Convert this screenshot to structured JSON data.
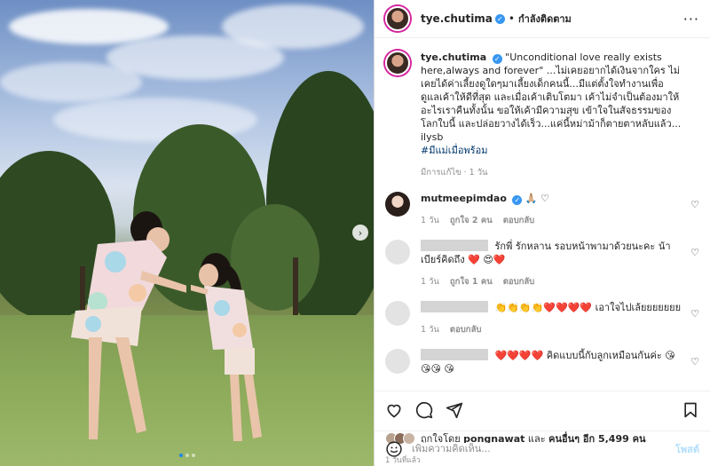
{
  "colors": {
    "accent": "#0095f6",
    "verified": "#3897f0",
    "heart": "#e0245e",
    "post_disabled": "#b2dffc"
  },
  "post": {
    "author": "tye.chutima",
    "following_label": "กำลังติดตาม",
    "more_icon": "more-horizontal-icon",
    "caption": "\"Unconditional love really exists here,always and forever\" ...ไม่เคยอยากได้เงินจากใคร ไม่เคยได้ค่าเลี้ยงดูใดๆมาเลี้ยงเด็กคนนี้...มีแต่ตั้งใจทำงานเพื่อดูแลเค้าให้ดีที่สุด และเมื่อเค้าเติบโตมา เค้าไม่จำเป็นต้องมาให้อะไรเราคืนทั้งนั้น ขอให้เค้ามีความสุข เข้าใจในสัจธรรมของโลกใบนี้ และปล่อยวางได้เร็ว...แค่นี้หม่าม้าก็ตายตาหลับแล้ว... ilysb",
    "hashtag": "#มีแม่เมื่อพร้อม",
    "caption_meta": "มีการแก้ไข · 1 วัน",
    "photo_nav_icon": "chevron-right-icon"
  },
  "comments": [
    {
      "user": "mutmeepimdao",
      "verified": true,
      "text": "🙏🏼 ♡",
      "time": "1 วัน",
      "likes": "ถูกใจ 2 คน",
      "reply": "ตอบกลับ"
    },
    {
      "user": "",
      "text": "รักพี่ รักหลาน รอบหน้าพามาด้วยนะคะ น้าเบียร์คิดถึง ❤️ 😍❤️",
      "time": "1 วัน",
      "likes": "ถูกใจ 1 คน",
      "reply": "ตอบกลับ"
    },
    {
      "user": "",
      "text": "👏👏👏👏❤️❤️❤️❤️ เอาใจไปเล้ยยยยยยย",
      "time": "1 วัน",
      "likes": "",
      "reply": "ตอบกลับ"
    },
    {
      "user": "",
      "text": "❤️❤️❤️❤️ คิดแบบนี้กับลูกเหมือนกันค่ะ 😘😘😘 😘",
      "time": "",
      "likes": "",
      "reply": ""
    }
  ],
  "actions": {
    "like_icon": "heart-icon",
    "comment_icon": "comment-icon",
    "share_icon": "share-icon",
    "save_icon": "bookmark-icon",
    "liked_by_prefix": "ถูกใจโดย",
    "liked_by_user": "pongnawat",
    "liked_by_and": "และ",
    "liked_by_others": "คนอื่นๆ อีก 5,499 คน",
    "posted_when": "1 วันที่แล้ว"
  },
  "add_comment": {
    "emoji_icon": "emoji-icon",
    "placeholder": "เพิ่มความคิดเห็น...",
    "post_label": "โพสต์"
  }
}
